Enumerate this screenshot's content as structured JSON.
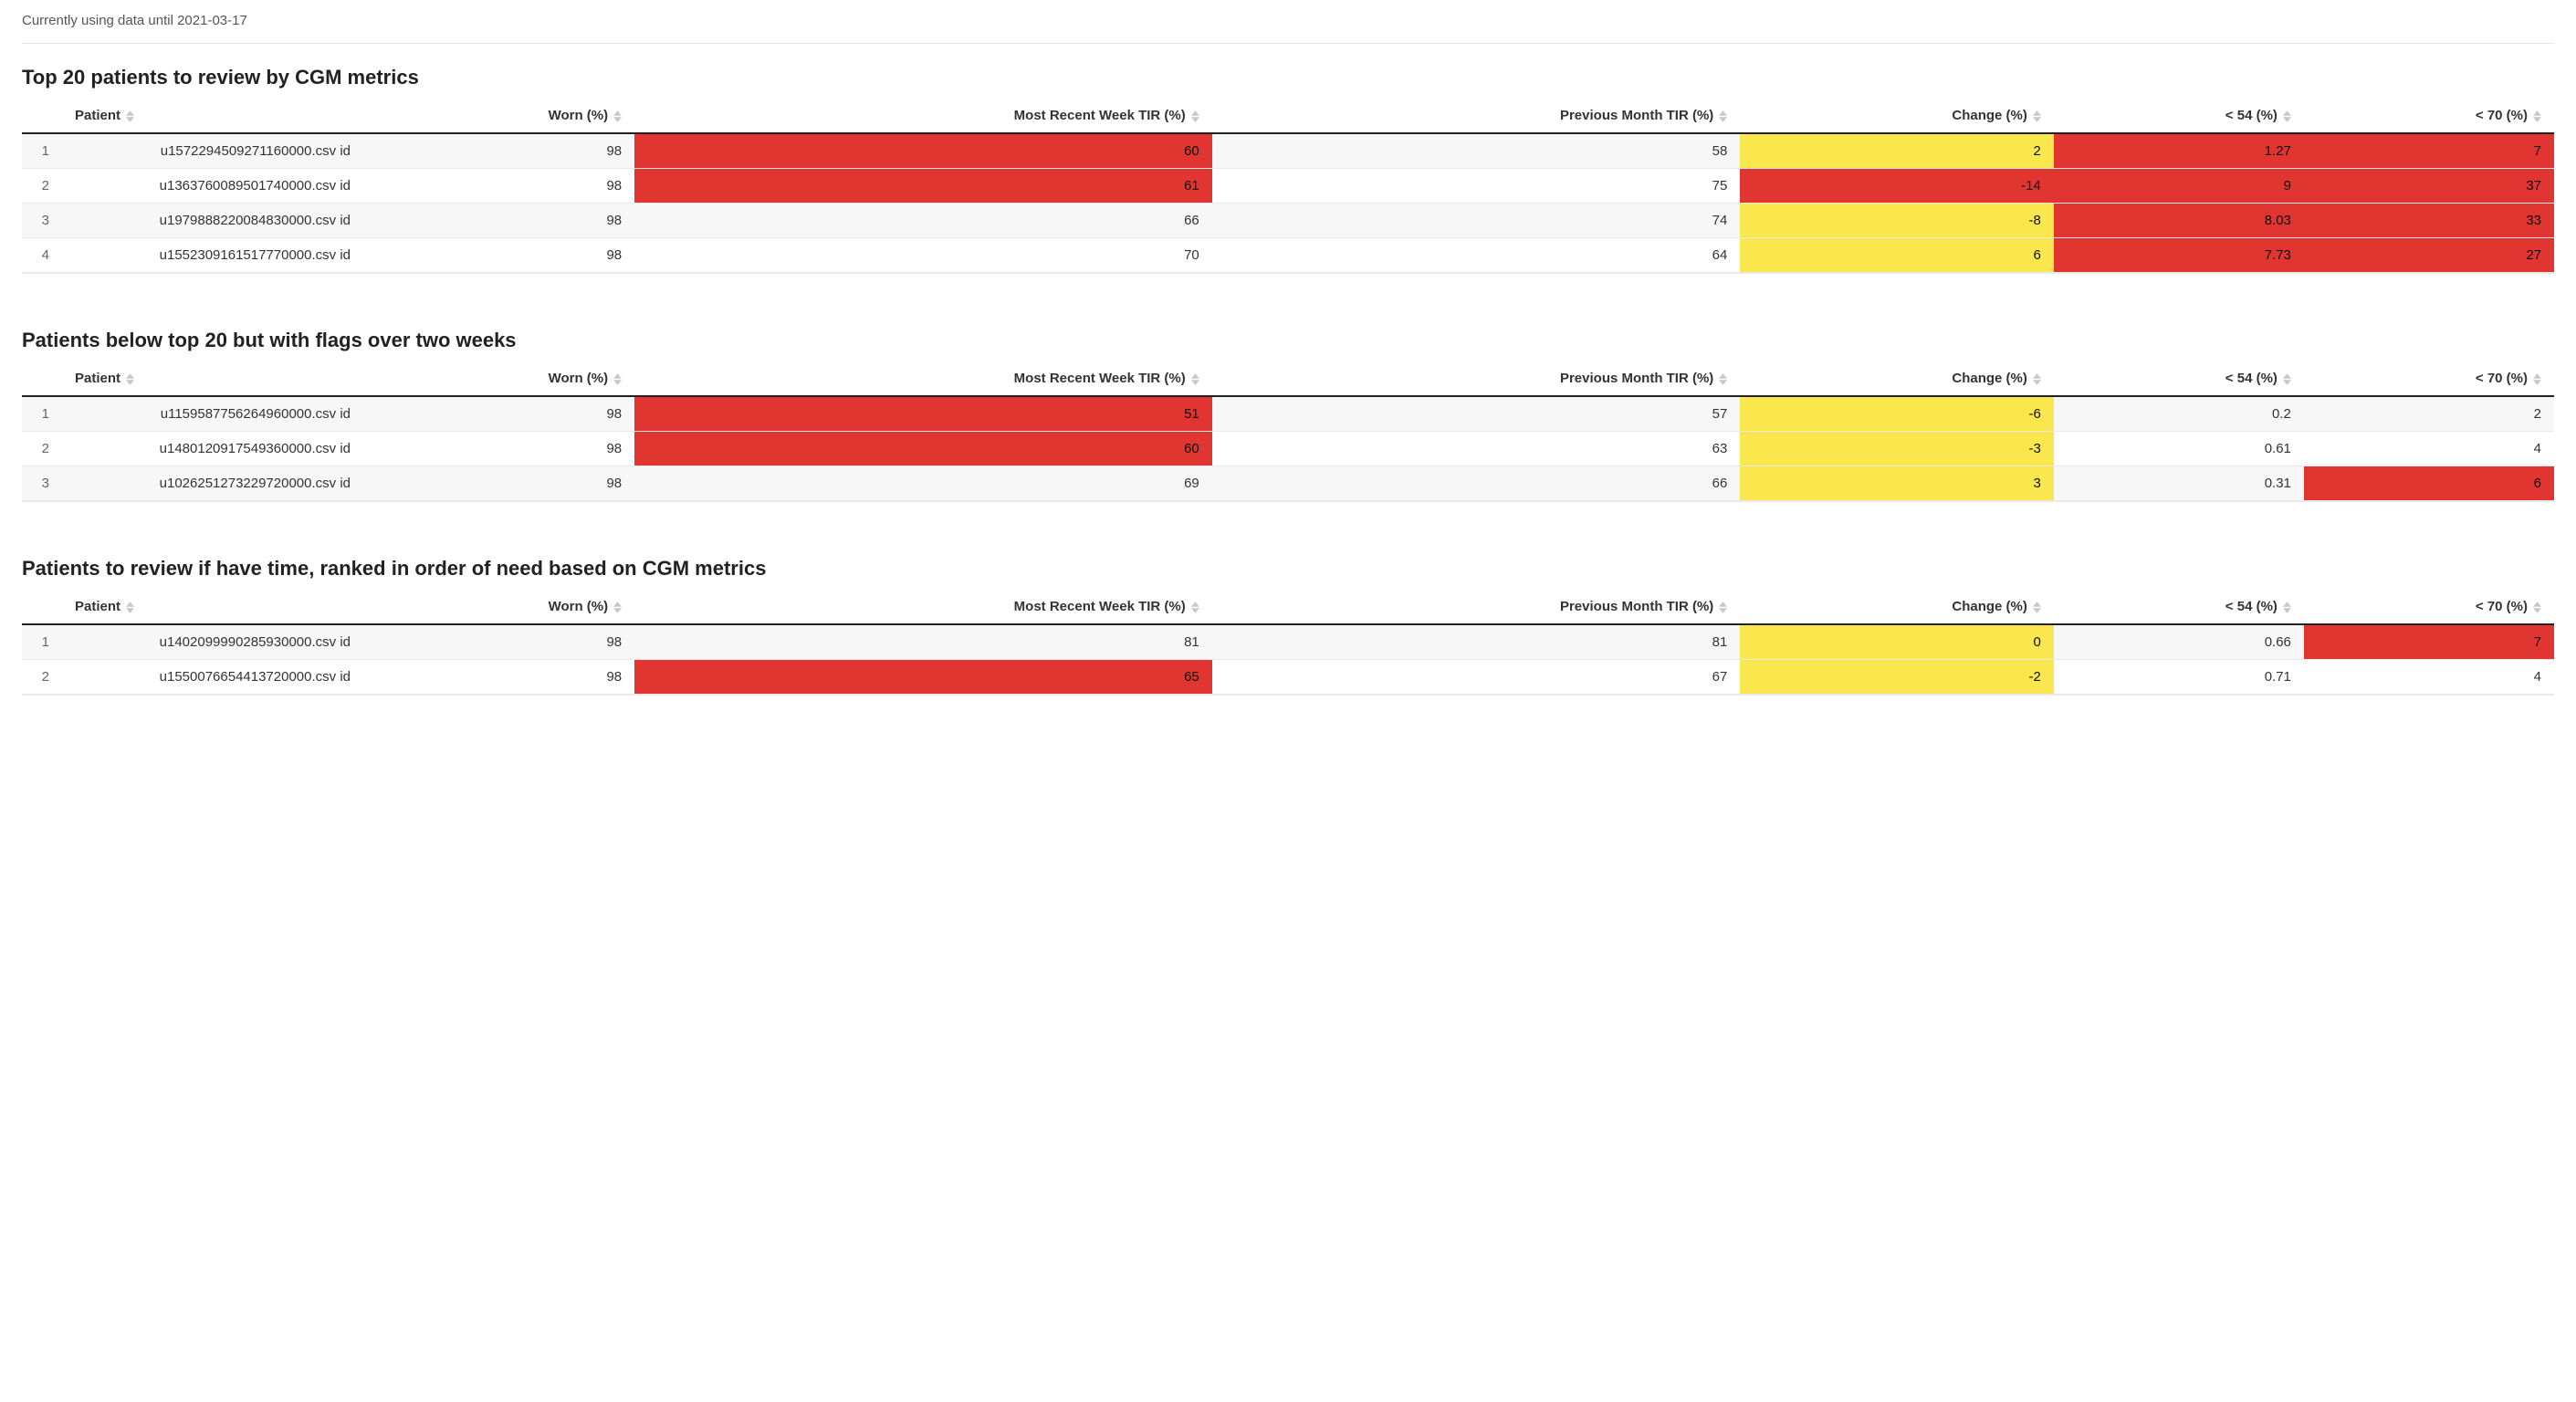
{
  "status_text": "Currently using data until 2021-03-17",
  "columns": {
    "patient": "Patient",
    "worn": "Worn (%)",
    "recent_tir": "Most Recent Week TIR (%)",
    "prev_tir": "Previous Month TIR (%)",
    "change": "Change (%)",
    "lt54": "< 54 (%)",
    "lt70": "< 70 (%)"
  },
  "colors": {
    "red": "#e03531",
    "yellow": "#f9e74d"
  },
  "sections": [
    {
      "title": "Top 20 patients to review by CGM metrics",
      "rows": [
        {
          "idx": "1",
          "patient": "u1572294509271160000.csv id",
          "worn": "98",
          "recent_tir": {
            "v": "60",
            "c": "red"
          },
          "prev_tir": {
            "v": "58"
          },
          "change": {
            "v": "2",
            "c": "yellow"
          },
          "lt54": {
            "v": "1.27",
            "c": "red"
          },
          "lt70": {
            "v": "7",
            "c": "red"
          }
        },
        {
          "idx": "2",
          "patient": "u1363760089501740000.csv id",
          "worn": "98",
          "recent_tir": {
            "v": "61",
            "c": "red"
          },
          "prev_tir": {
            "v": "75"
          },
          "change": {
            "v": "-14",
            "c": "red"
          },
          "lt54": {
            "v": "9",
            "c": "red"
          },
          "lt70": {
            "v": "37",
            "c": "red"
          }
        },
        {
          "idx": "3",
          "patient": "u1979888220084830000.csv id",
          "worn": "98",
          "recent_tir": {
            "v": "66"
          },
          "prev_tir": {
            "v": "74"
          },
          "change": {
            "v": "-8",
            "c": "yellow"
          },
          "lt54": {
            "v": "8.03",
            "c": "red"
          },
          "lt70": {
            "v": "33",
            "c": "red"
          }
        },
        {
          "idx": "4",
          "patient": "u1552309161517770000.csv id",
          "worn": "98",
          "recent_tir": {
            "v": "70"
          },
          "prev_tir": {
            "v": "64"
          },
          "change": {
            "v": "6",
            "c": "yellow"
          },
          "lt54": {
            "v": "7.73",
            "c": "red"
          },
          "lt70": {
            "v": "27",
            "c": "red"
          }
        }
      ]
    },
    {
      "title": "Patients below top 20 but with flags over two weeks",
      "rows": [
        {
          "idx": "1",
          "patient": "u1159587756264960000.csv id",
          "worn": "98",
          "recent_tir": {
            "v": "51",
            "c": "red"
          },
          "prev_tir": {
            "v": "57"
          },
          "change": {
            "v": "-6",
            "c": "yellow"
          },
          "lt54": {
            "v": "0.2"
          },
          "lt70": {
            "v": "2"
          }
        },
        {
          "idx": "2",
          "patient": "u1480120917549360000.csv id",
          "worn": "98",
          "recent_tir": {
            "v": "60",
            "c": "red"
          },
          "prev_tir": {
            "v": "63"
          },
          "change": {
            "v": "-3",
            "c": "yellow"
          },
          "lt54": {
            "v": "0.61"
          },
          "lt70": {
            "v": "4"
          }
        },
        {
          "idx": "3",
          "patient": "u1026251273229720000.csv id",
          "worn": "98",
          "recent_tir": {
            "v": "69"
          },
          "prev_tir": {
            "v": "66"
          },
          "change": {
            "v": "3",
            "c": "yellow"
          },
          "lt54": {
            "v": "0.31"
          },
          "lt70": {
            "v": "6",
            "c": "red"
          }
        }
      ]
    },
    {
      "title": "Patients to review if have time, ranked in order of need based on CGM metrics",
      "rows": [
        {
          "idx": "1",
          "patient": "u1402099990285930000.csv id",
          "worn": "98",
          "recent_tir": {
            "v": "81"
          },
          "prev_tir": {
            "v": "81"
          },
          "change": {
            "v": "0",
            "c": "yellow"
          },
          "lt54": {
            "v": "0.66"
          },
          "lt70": {
            "v": "7",
            "c": "red"
          }
        },
        {
          "idx": "2",
          "patient": "u1550076654413720000.csv id",
          "worn": "98",
          "recent_tir": {
            "v": "65",
            "c": "red"
          },
          "prev_tir": {
            "v": "67"
          },
          "change": {
            "v": "-2",
            "c": "yellow"
          },
          "lt54": {
            "v": "0.71"
          },
          "lt70": {
            "v": "4"
          }
        }
      ]
    }
  ]
}
